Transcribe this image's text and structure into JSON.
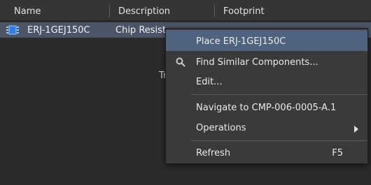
{
  "table": {
    "columns": [
      "Name",
      "Description",
      "Footprint"
    ],
    "rows": [
      {
        "name": "ERJ-1GEJ150C",
        "description": "Chip Resisto",
        "footprint": ""
      }
    ]
  },
  "background": {
    "partial_text": "Tr"
  },
  "context_menu": {
    "items": [
      {
        "label": "Place ERJ-1GEJ150C",
        "icon": "",
        "highlighted": true
      },
      {
        "label": "Find Similar Components...",
        "icon": "search-icon"
      },
      {
        "label": "Edit..."
      },
      {
        "label": "Navigate to CMP-006-0005-A.1"
      },
      {
        "label": "Operations",
        "submenu": true
      },
      {
        "label": "Refresh",
        "shortcut": "F5"
      }
    ]
  },
  "colors": {
    "selection": "#4b5566",
    "menu_highlight": "#4f627f",
    "icon_blue": "#2d7ee6"
  }
}
